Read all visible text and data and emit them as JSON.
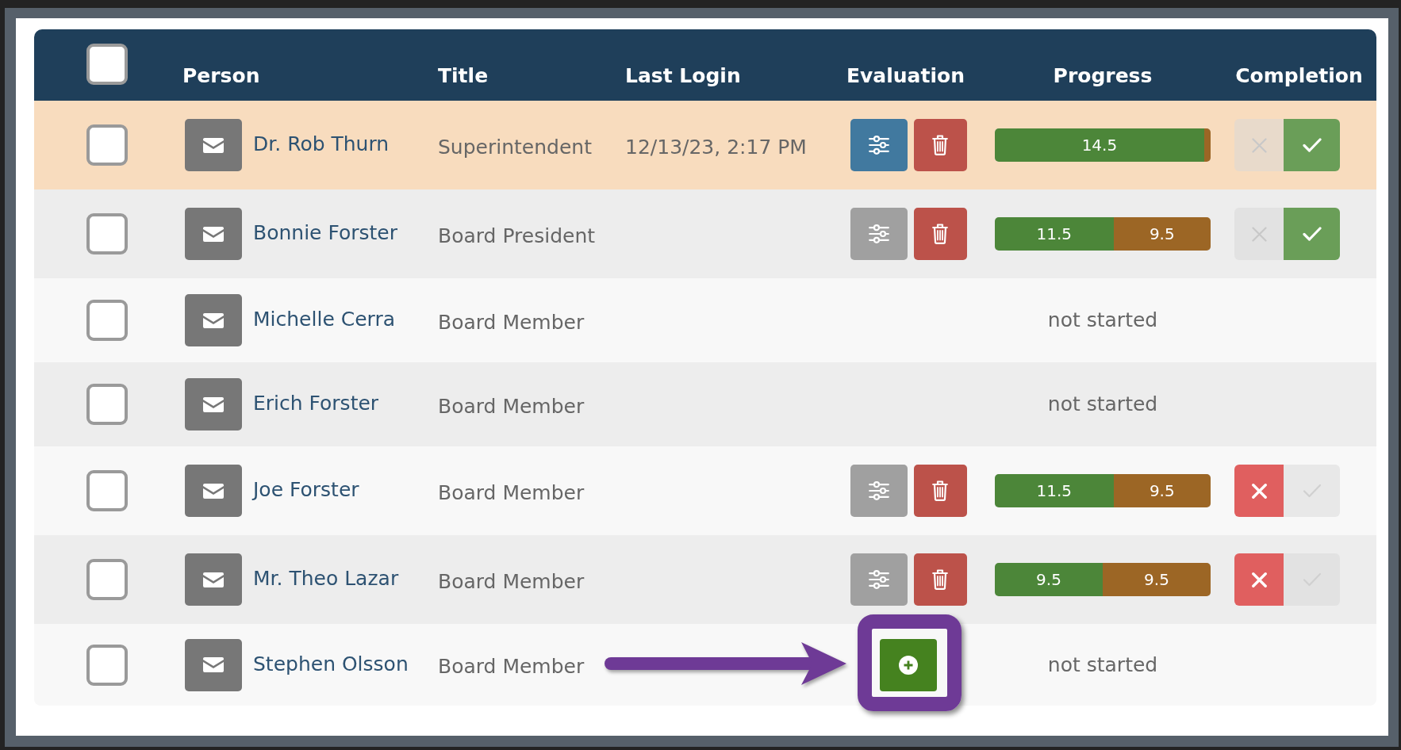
{
  "header": {
    "select_all": {
      "checked": false
    },
    "columns": [
      "Person",
      "Title",
      "Last Login",
      "Evaluation",
      "Progress",
      "Completion"
    ]
  },
  "rows": [
    {
      "checked": false,
      "highlighted": true,
      "name": "Dr. Rob Thurn",
      "title": "Superintendent",
      "last_login": "12/13/23, 2:17 PM",
      "evaluation": {
        "kind": "edit",
        "active": true,
        "callout": false
      },
      "progress": {
        "kind": "bar",
        "segments": [
          {
            "label": "14.5",
            "level": 0.97,
            "color": "#4c8639"
          },
          {
            "level": 0.03,
            "color": "#9c6625"
          }
        ]
      },
      "completion": {
        "completed": true
      }
    },
    {
      "checked": false,
      "highlighted": false,
      "name": "Bonnie Forster",
      "title": "Board President",
      "evaluation": {
        "kind": "edit",
        "active": false,
        "callout": false
      },
      "progress": {
        "kind": "bar",
        "segments": [
          {
            "label": "11.5",
            "level": 0.55,
            "color": "#4c8639"
          },
          {
            "label": "9.5",
            "level": 0.45,
            "color": "#9c6625"
          }
        ]
      },
      "completion": {
        "completed": true
      }
    },
    {
      "checked": false,
      "highlighted": false,
      "name": "Michelle Cerra",
      "title": "Board Member",
      "progress": {
        "kind": "text",
        "text": "not started"
      }
    },
    {
      "checked": false,
      "highlighted": false,
      "name": "Erich Forster",
      "title": "Board Member",
      "progress": {
        "kind": "text",
        "text": "not started"
      }
    },
    {
      "checked": false,
      "highlighted": false,
      "name": "Joe Forster",
      "title": "Board Member",
      "evaluation": {
        "kind": "edit",
        "active": false,
        "callout": false
      },
      "progress": {
        "kind": "bar",
        "segments": [
          {
            "label": "11.5",
            "level": 0.55,
            "color": "#4c8639"
          },
          {
            "label": "9.5",
            "level": 0.45,
            "color": "#9c6625"
          }
        ]
      },
      "completion": {
        "completed": false
      }
    },
    {
      "checked": false,
      "highlighted": false,
      "name": "Mr. Theo Lazar",
      "title": "Board Member",
      "evaluation": {
        "kind": "edit",
        "active": false,
        "callout": false
      },
      "progress": {
        "kind": "bar",
        "segments": [
          {
            "label": "9.5",
            "level": 0.5,
            "color": "#4c8639"
          },
          {
            "label": "9.5",
            "level": 0.5,
            "color": "#9c6625"
          }
        ]
      },
      "completion": {
        "completed": false
      }
    },
    {
      "checked": false,
      "highlighted": false,
      "name": "Stephen Olsson",
      "title": "Board Member",
      "evaluation": {
        "kind": "add",
        "callout": true
      },
      "progress": {
        "kind": "text",
        "text": "not started"
      }
    }
  ]
}
